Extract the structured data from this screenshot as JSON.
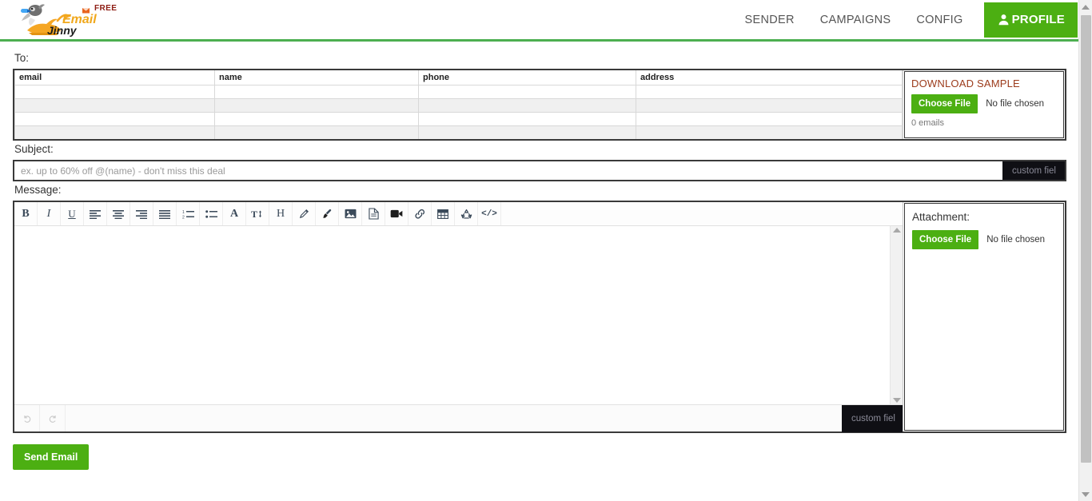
{
  "header": {
    "brand": {
      "name_line1": "Email",
      "name_line2": "Jinny",
      "badge": "FREE",
      "logo_icon": "genie-lamp-icon"
    },
    "nav": [
      {
        "label": "SENDER",
        "name": "nav-sender"
      },
      {
        "label": "CAMPAIGNS",
        "name": "nav-campaigns"
      },
      {
        "label": "CONFIG",
        "name": "nav-config"
      }
    ],
    "profile_button": {
      "label": "PROFILE",
      "icon": "user-icon",
      "bg": "#4caf12"
    }
  },
  "to_section": {
    "label": "To:",
    "table": {
      "columns": [
        "email",
        "name",
        "phone",
        "address"
      ],
      "rows": [
        [
          "",
          "",
          "",
          ""
        ],
        [
          "",
          "",
          "",
          ""
        ],
        [
          "",
          "",
          "",
          ""
        ],
        [
          "",
          "",
          "",
          ""
        ]
      ]
    },
    "upload_panel": {
      "download_sample_label": "DOWNLOAD SAMPLE",
      "download_sample_color": "#9c3b1b",
      "choose_file_label": "Choose File",
      "no_file_label": "No file chosen",
      "emails_count": "0 emails"
    }
  },
  "subject_section": {
    "label": "Subject:",
    "placeholder": "ex. up to 60% off @(name) - don't miss this deal",
    "value": "",
    "custom_field_label": "custom fiel"
  },
  "message_section": {
    "label": "Message:",
    "toolbar": [
      {
        "name": "bold-icon",
        "glyph": "B",
        "title": "Bold"
      },
      {
        "name": "italic-icon",
        "glyph": "I",
        "title": "Italic"
      },
      {
        "name": "underline-icon",
        "glyph": "U",
        "title": "Underline"
      },
      {
        "name": "align-left-icon",
        "glyph": "",
        "title": "Align left"
      },
      {
        "name": "align-center-icon",
        "glyph": "",
        "title": "Align center"
      },
      {
        "name": "align-right-icon",
        "glyph": "",
        "title": "Align right"
      },
      {
        "name": "align-justify-icon",
        "glyph": "",
        "title": "Justify"
      },
      {
        "name": "ordered-list-icon",
        "glyph": "",
        "title": "Numbered list"
      },
      {
        "name": "unordered-list-icon",
        "glyph": "",
        "title": "Bulleted list"
      },
      {
        "name": "font-color-icon",
        "glyph": "A",
        "title": "Font color"
      },
      {
        "name": "font-size-icon",
        "glyph": "T",
        "title": "Font size"
      },
      {
        "name": "heading-icon",
        "glyph": "H",
        "title": "Heading"
      },
      {
        "name": "pencil-icon",
        "glyph": "",
        "title": "Pen"
      },
      {
        "name": "brush-icon",
        "glyph": "",
        "title": "Highlighter"
      },
      {
        "name": "image-icon",
        "glyph": "",
        "title": "Insert image"
      },
      {
        "name": "file-icon",
        "glyph": "",
        "title": "Insert file"
      },
      {
        "name": "video-icon",
        "glyph": "",
        "title": "Insert video"
      },
      {
        "name": "link-icon",
        "glyph": "",
        "title": "Insert link"
      },
      {
        "name": "table-icon",
        "glyph": "",
        "title": "Insert table"
      },
      {
        "name": "recycle-icon",
        "glyph": "",
        "title": "Clear formatting"
      },
      {
        "name": "code-icon",
        "glyph": "</>",
        "title": "Code view"
      }
    ],
    "body_value": "",
    "footer": {
      "undo_icon": "undo-icon",
      "redo_icon": "redo-icon",
      "custom_field_label": "custom fiel"
    },
    "attachment": {
      "label": "Attachment:",
      "choose_file_label": "Choose File",
      "no_file_label": "No file chosen"
    }
  },
  "footer": {
    "send_label": "Send Email"
  },
  "scrollbar": {
    "up_icon": "scroll-up-arrow-icon",
    "down_icon": "scroll-down-arrow-icon"
  }
}
